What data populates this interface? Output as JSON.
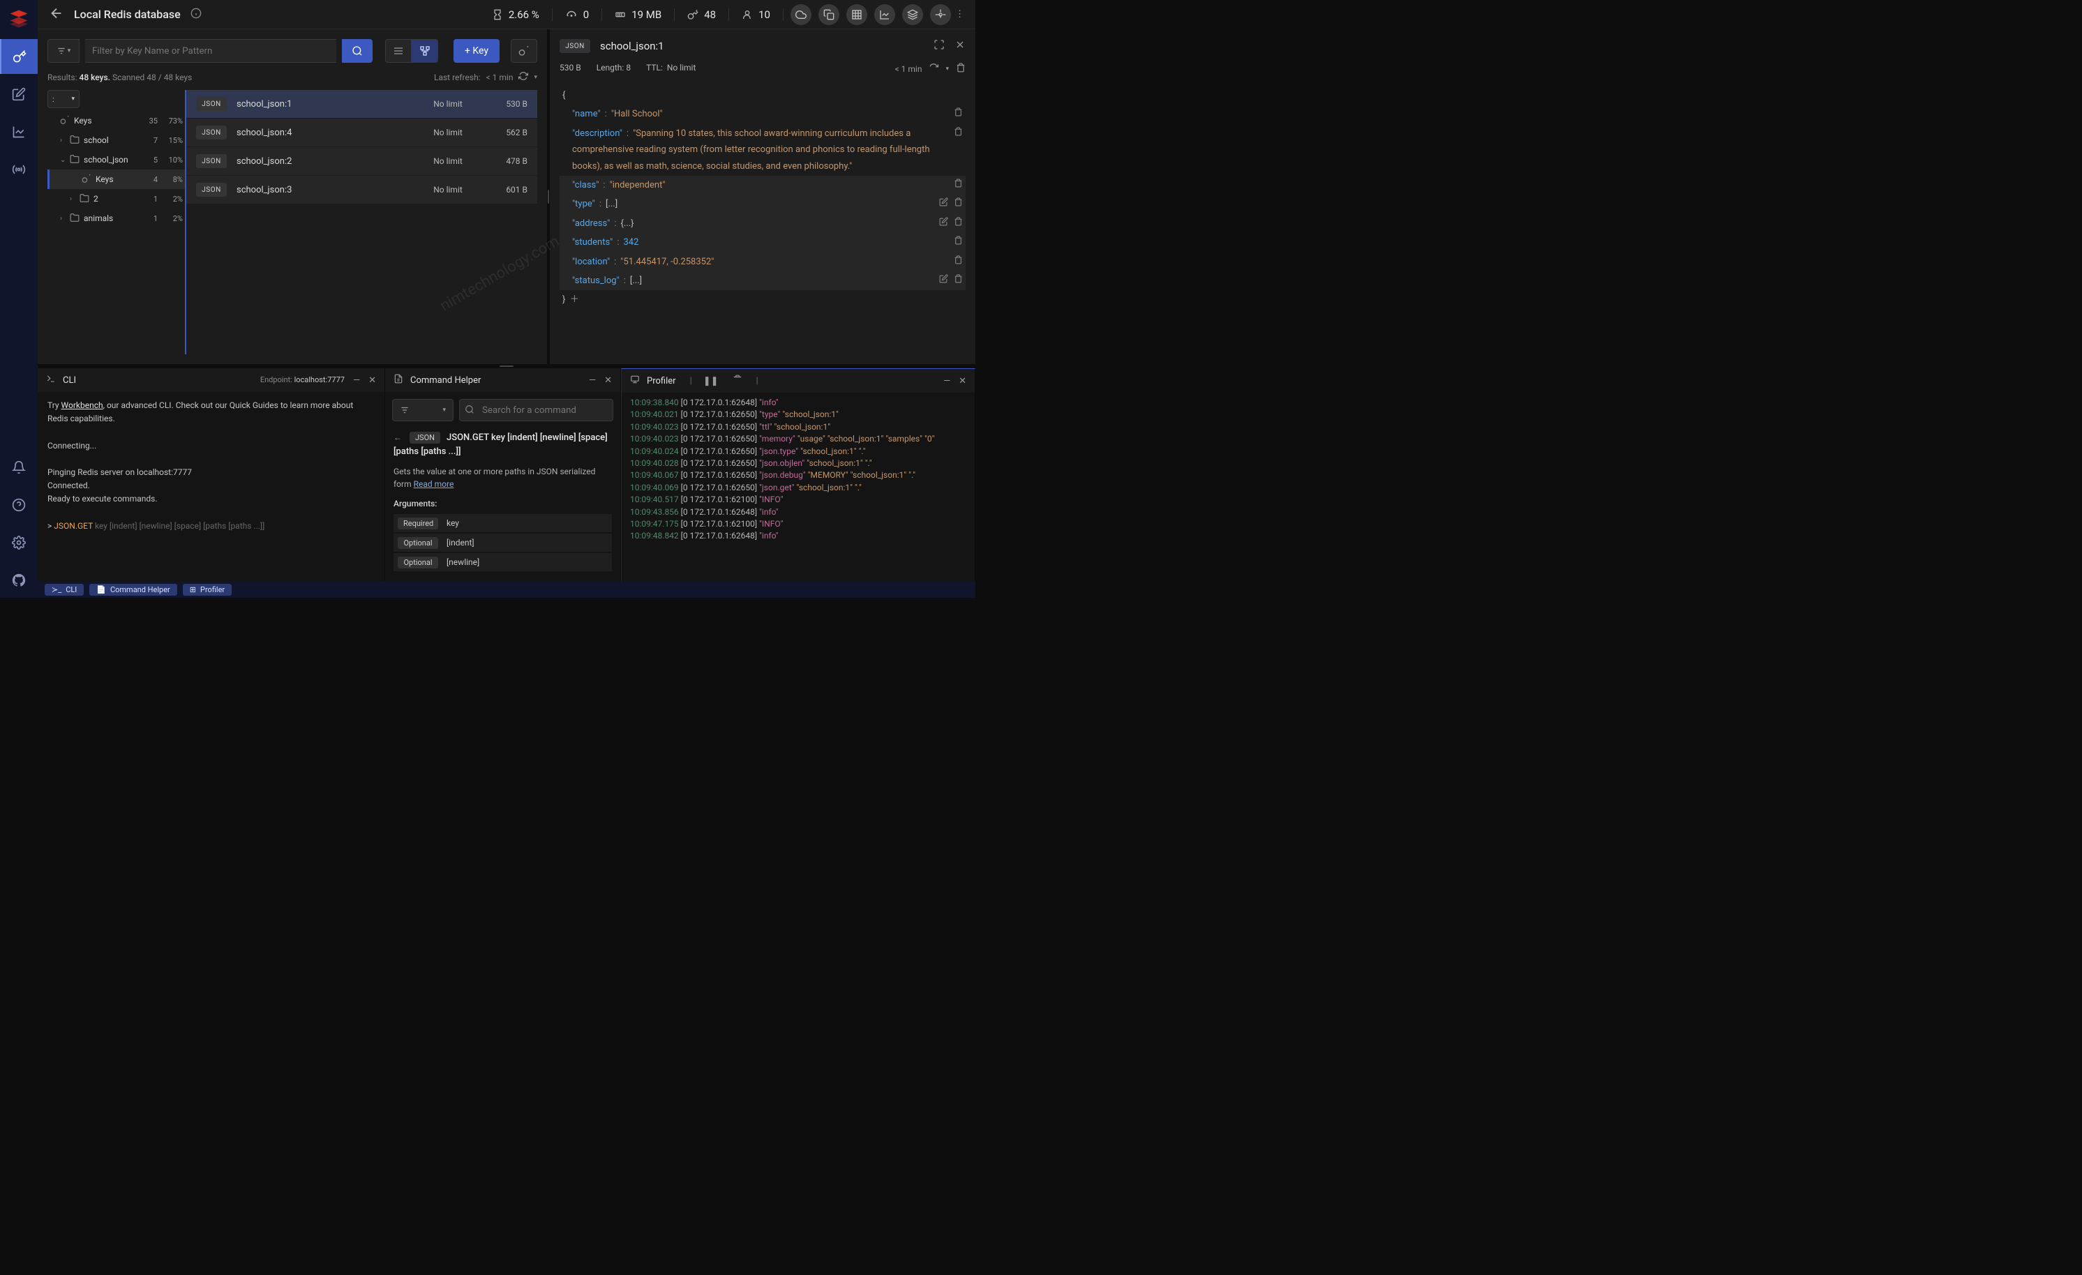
{
  "header": {
    "title": "Local Redis database",
    "metrics": {
      "cpu": "2.66 %",
      "commands": "0",
      "memory": "19 MB",
      "keys": "48",
      "clients": "10"
    }
  },
  "keys": {
    "filter_placeholder": "Filter by Key Name or Pattern",
    "add_key": "+ Key",
    "results_label": "Results:",
    "results_value": "48 keys.",
    "scanned": "Scanned 48 / 48 keys",
    "last_refresh_label": "Last refresh:",
    "last_refresh_value": "< 1 min",
    "delimiter": ":",
    "tree": [
      {
        "icon": "key",
        "label": "Keys",
        "count": "35",
        "pct": "73%",
        "indent": 0,
        "chev": ""
      },
      {
        "icon": "folder",
        "label": "school",
        "count": "7",
        "pct": "15%",
        "indent": 1,
        "chev": "›"
      },
      {
        "icon": "folder",
        "label": "school_json",
        "count": "5",
        "pct": "10%",
        "indent": 1,
        "chev": "⌄"
      },
      {
        "icon": "key",
        "label": "Keys",
        "count": "4",
        "pct": "8%",
        "indent": 2,
        "chev": "",
        "selected": true
      },
      {
        "icon": "folder",
        "label": "2",
        "count": "1",
        "pct": "2%",
        "indent": 2,
        "chev": "›"
      },
      {
        "icon": "folder",
        "label": "animals",
        "count": "1",
        "pct": "2%",
        "indent": 1,
        "chev": "›"
      }
    ],
    "list": [
      {
        "type": "JSON",
        "name": "school_json:1",
        "ttl": "No limit",
        "size": "530 B",
        "selected": true
      },
      {
        "type": "JSON",
        "name": "school_json:4",
        "ttl": "No limit",
        "size": "562 B"
      },
      {
        "type": "JSON",
        "name": "school_json:2",
        "ttl": "No limit",
        "size": "478 B"
      },
      {
        "type": "JSON",
        "name": "school_json:3",
        "ttl": "No limit",
        "size": "601 B"
      }
    ]
  },
  "detail": {
    "type": "JSON",
    "key": "school_json:1",
    "size": "530 B",
    "length_label": "Length:",
    "length_value": "8",
    "ttl_label": "TTL:",
    "ttl_value": "No limit",
    "refresh": "< 1 min",
    "json": [
      {
        "k": "\"name\"",
        "v": "\"Hall School\"",
        "t": "str",
        "del": true
      },
      {
        "k": "\"description\"",
        "v": "\"Spanning 10 states, this school award-winning curriculum includes a comprehensive reading system (from letter recognition and phonics to reading full-length books), as well as math, science, social studies, and even philosophy.\"",
        "t": "str",
        "del": true
      },
      {
        "k": "\"class\"",
        "v": "\"independent\"",
        "t": "str",
        "del": true
      },
      {
        "k": "\"type\"",
        "v": "[...]",
        "t": "punc",
        "edit": true,
        "del": true
      },
      {
        "k": "\"address\"",
        "v": "{...}",
        "t": "punc",
        "edit": true,
        "del": true
      },
      {
        "k": "\"students\"",
        "v": "342",
        "t": "num",
        "del": true
      },
      {
        "k": "\"location\"",
        "v": "\"51.445417, -0.258352\"",
        "t": "str",
        "del": true
      },
      {
        "k": "\"status_log\"",
        "v": "[...]",
        "t": "punc",
        "edit": true,
        "del": true
      }
    ]
  },
  "cli": {
    "title": "CLI",
    "endpoint_label": "Endpoint:",
    "endpoint_value": "localhost:7777",
    "line1_a": "Try ",
    "line1_link": "Workbench",
    "line1_b": ", our advanced CLI. Check out our Quick Guides to learn more about Redis capabilities.",
    "line2": "Connecting...",
    "line3": "Pinging Redis server on localhost:7777",
    "line4": "Connected.",
    "line5": "Ready to execute commands.",
    "prompt": ">",
    "cmd": "JSON.GET",
    "cmd_args": "key [indent] [newline] [space] [paths [paths ...]]"
  },
  "helper": {
    "title": "Command Helper",
    "search_placeholder": "Search for a command",
    "chip": "JSON",
    "cmd": "JSON.GET key [indent] [newline] [space] [paths [paths ...]]",
    "desc": "Gets the value at one or more paths in JSON serialized form  ",
    "read_more": "Read more",
    "args_title": "Arguments:",
    "args": [
      {
        "req": "Required",
        "name": "key"
      },
      {
        "req": "Optional",
        "name": "[indent]"
      },
      {
        "req": "Optional",
        "name": "[newline]"
      }
    ]
  },
  "profiler": {
    "title": "Profiler",
    "logs": [
      {
        "t": "10:09:38.840",
        "s": "[0 172.17.0.1:62648]",
        "c": "\"info\"",
        "a": ""
      },
      {
        "t": "10:09:40.021",
        "s": "[0 172.17.0.1:62650]",
        "c": "\"type\"",
        "a": "\"school_json:1\""
      },
      {
        "t": "10:09:40.023",
        "s": "[0 172.17.0.1:62650]",
        "c": "\"ttl\"",
        "a": "\"school_json:1\""
      },
      {
        "t": "10:09:40.023",
        "s": "[0 172.17.0.1:62650]",
        "c": "\"memory\"",
        "a": "\"usage\" \"school_json:1\" \"samples\" \"0\""
      },
      {
        "t": "10:09:40.024",
        "s": "[0 172.17.0.1:62650]",
        "c": "\"json.type\"",
        "a": "\"school_json:1\" \".\""
      },
      {
        "t": "10:09:40.028",
        "s": "[0 172.17.0.1:62650]",
        "c": "\"json.objlen\"",
        "a": "\"school_json:1\" \".\""
      },
      {
        "t": "10:09:40.067",
        "s": "[0 172.17.0.1:62650]",
        "c": "\"json.debug\"",
        "a": "\"MEMORY\" \"school_json:1\" \".\""
      },
      {
        "t": "10:09:40.069",
        "s": "[0 172.17.0.1:62650]",
        "c": "\"json.get\"",
        "a": "\"school_json:1\" \".\""
      },
      {
        "t": "10:09:40.517",
        "s": "[0 172.17.0.1:62100]",
        "c": "\"INFO\"",
        "a": ""
      },
      {
        "t": "10:09:43.856",
        "s": "[0 172.17.0.1:62648]",
        "c": "\"info\"",
        "a": ""
      },
      {
        "t": "10:09:47.175",
        "s": "[0 172.17.0.1:62100]",
        "c": "\"INFO\"",
        "a": ""
      },
      {
        "t": "10:09:48.842",
        "s": "[0 172.17.0.1:62648]",
        "c": "\"info\"",
        "a": ""
      }
    ]
  },
  "footer": {
    "cli": "CLI",
    "helper": "Command Helper",
    "profiler": "Profiler"
  },
  "watermark": "nimtechnology.com"
}
